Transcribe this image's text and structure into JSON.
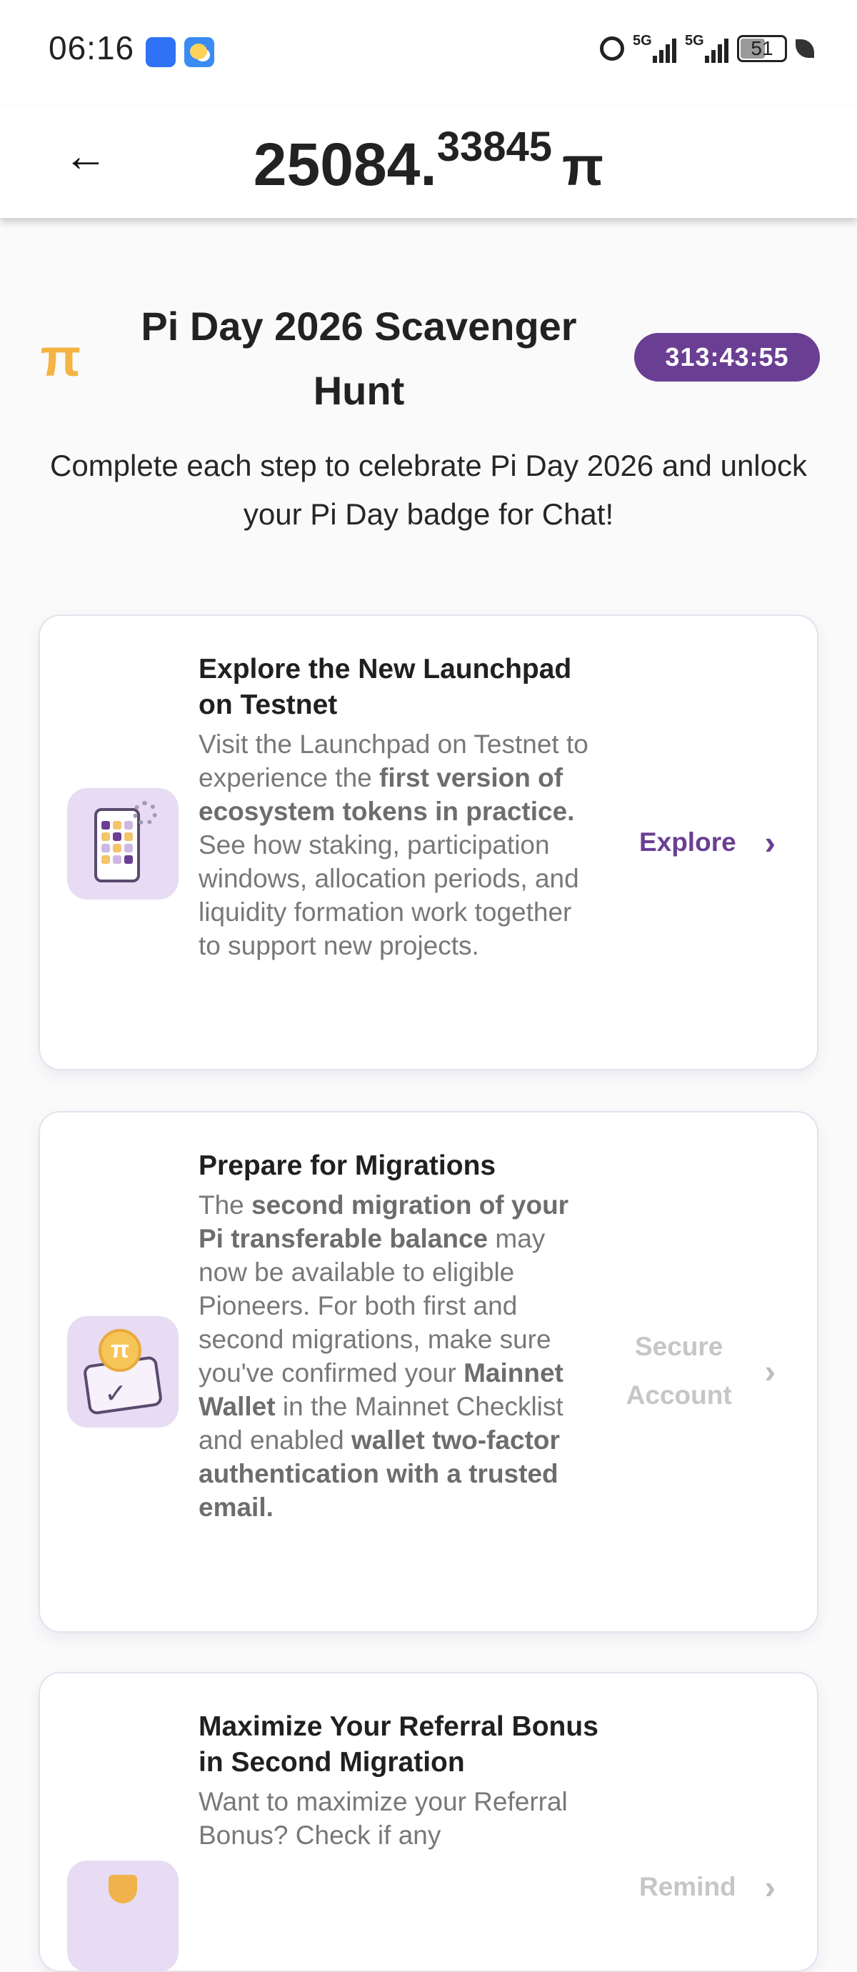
{
  "status_bar": {
    "time": "06:16",
    "network_1": "5G",
    "network_2": "5G",
    "battery": "51"
  },
  "header": {
    "balance_int": "25084.",
    "balance_dec": "33845",
    "currency": "π"
  },
  "event": {
    "title": "Pi Day 2026 Scavenger Hunt",
    "countdown": "313:43:55",
    "subtitle": "Complete each step to celebrate Pi Day 2026 and unlock your Pi Day badge for Chat!"
  },
  "tasks": [
    {
      "title": "Explore the New Launchpad on Testnet",
      "desc_parts": [
        "Visit the Launchpad on Testnet to experience the ",
        "first version of ecosystem tokens in practice.",
        " See how staking, participation windows, allocation periods, and liquidity formation work together to support new projects."
      ],
      "action": "Explore",
      "action_enabled": true,
      "icon": "launchpad-phone-icon"
    },
    {
      "title": "Prepare for Migrations",
      "desc_parts": [
        "The ",
        "second migration of your Pi transferable balance",
        " may now be available to eligible Pioneers. For both first and second migrations, make sure you've confirmed your ",
        "Mainnet Wallet",
        " in the Mainnet Checklist and enabled ",
        "wallet two-factor authentication with a trusted email."
      ],
      "action": "Secure Account",
      "action_enabled": false,
      "icon": "wallet-coin-icon"
    },
    {
      "title": "Maximize Your Referral Bonus in Second Migration",
      "desc_parts": [
        "Want to maximize your Referral Bonus? Check if any"
      ],
      "action": "Remind",
      "action_enabled": false,
      "icon": "referral-shield-icon"
    }
  ],
  "colors": {
    "accent": "#6a3f93",
    "pi_gold": "#f3b443",
    "icon_bg": "#e8dcf4"
  }
}
